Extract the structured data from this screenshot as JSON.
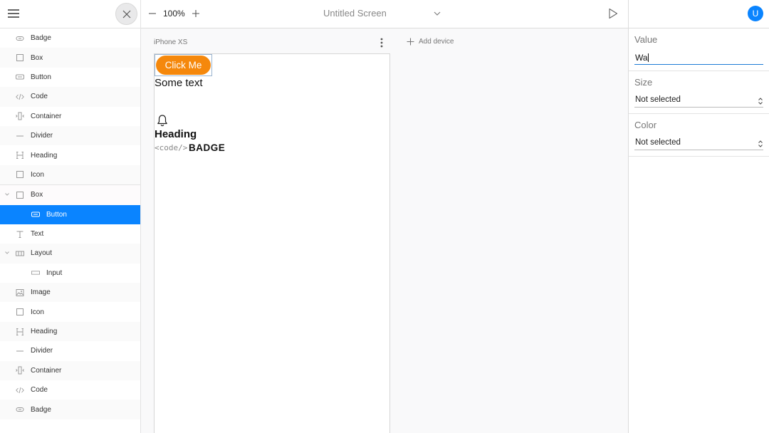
{
  "toolbar": {
    "zoom": "100%",
    "screen_title": "Untitled Screen"
  },
  "sidebar": {
    "items": [
      {
        "label": "Badge",
        "icon": "badge-icon"
      },
      {
        "label": "Box",
        "icon": "box-icon"
      },
      {
        "label": "Button",
        "icon": "button-icon"
      },
      {
        "label": "Code",
        "icon": "code-icon"
      },
      {
        "label": "Container",
        "icon": "container-icon"
      },
      {
        "label": "Divider",
        "icon": "divider-icon"
      },
      {
        "label": "Heading",
        "icon": "heading-icon"
      },
      {
        "label": "Icon",
        "icon": "icon-icon"
      }
    ],
    "tree": [
      {
        "label": "Box",
        "icon": "box-icon",
        "expanded": true
      },
      {
        "label": "Button",
        "icon": "button-icon",
        "selected": true
      },
      {
        "label": "Text",
        "icon": "text-icon"
      },
      {
        "label": "Layout",
        "icon": "layout-icon",
        "expanded": true
      },
      {
        "label": "Input",
        "icon": "input-icon"
      },
      {
        "label": "Image",
        "icon": "image-icon"
      },
      {
        "label": "Icon",
        "icon": "icon-icon"
      },
      {
        "label": "Heading",
        "icon": "heading-icon"
      },
      {
        "label": "Divider",
        "icon": "divider-icon"
      },
      {
        "label": "Container",
        "icon": "container-icon"
      },
      {
        "label": "Code",
        "icon": "code-icon"
      },
      {
        "label": "Badge",
        "icon": "badge-icon"
      }
    ]
  },
  "canvas": {
    "device_name": "iPhone XS",
    "add_device": "Add device",
    "preview": {
      "button": "Click Me",
      "text": "Some text",
      "heading": "Heading",
      "code": "<code/>",
      "badge": "BADGE"
    }
  },
  "properties": {
    "avatar": "U",
    "value_label": "Value",
    "value": "Wa",
    "size_label": "Size",
    "size_value": "Not selected",
    "color_label": "Color",
    "color_value": "Not selected"
  },
  "colors": {
    "accent": "#0a84ff",
    "button_orange": "#f5880c"
  }
}
